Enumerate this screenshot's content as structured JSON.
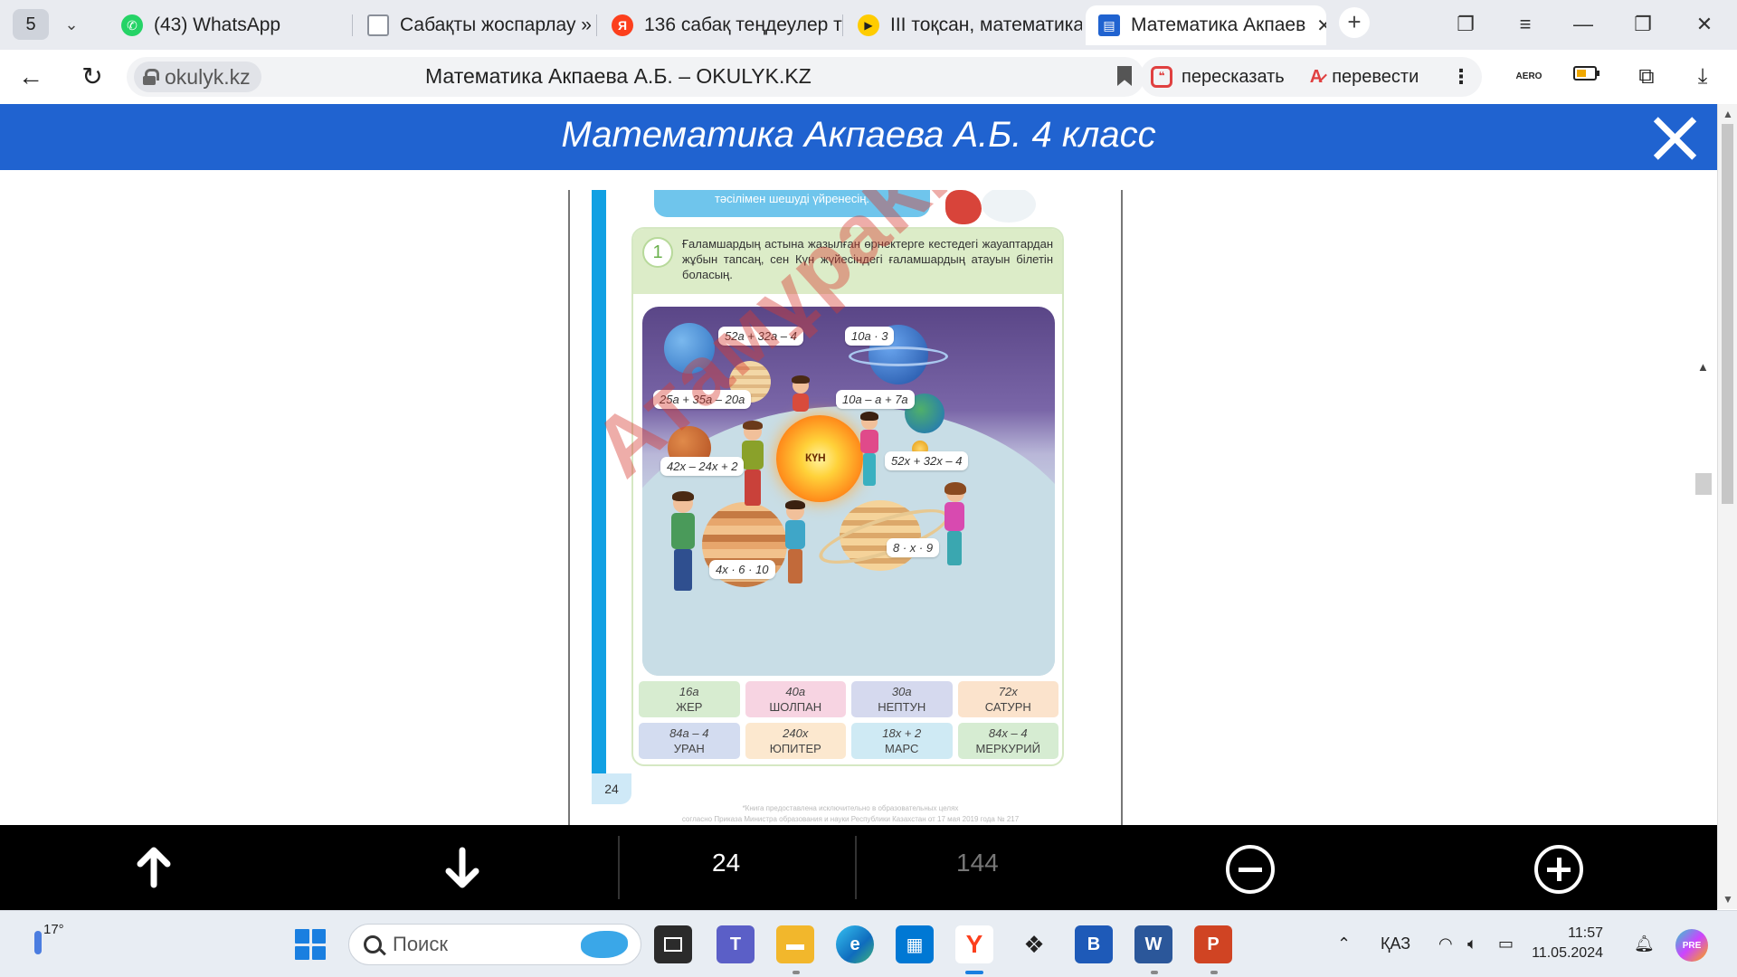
{
  "browser": {
    "tab_count": "5",
    "tabs": [
      {
        "label": "(43) WhatsApp",
        "icon": "whatsapp-icon",
        "color": "#25d366"
      },
      {
        "label": "Сабақты жоспарлау »",
        "icon": "document-icon",
        "color": "#8a8f99"
      },
      {
        "label": "136 сабақ теңдеулер т",
        "icon": "yandex-icon",
        "color": "#fc3f1d"
      },
      {
        "label": "III тоқсан, математика",
        "icon": "video-play-icon",
        "color": "#ffcc00"
      },
      {
        "label": "Математика Акпаев",
        "icon": "book-icon",
        "color": "#2063d0"
      }
    ],
    "domain": "okulyk.kz",
    "page_title": "Математика Акпаева А.Б. – OKULYK.KZ",
    "retell_label": "пересказать",
    "translate_label": "перевести",
    "aero_label": "AERO"
  },
  "header": {
    "title": "Математика Акпаева А.Б. 4 класс"
  },
  "book": {
    "top_banner": "тәсілімен шешуді үйренесің.",
    "exercise_number": "1",
    "exercise_text": "Ғаламшардың астына жазылған өрнектерге кестедегі жауаптардан жұбын тапсаң, сен Күн жүйесіндегі ғаламшардың атауын білетін боласың.",
    "sun_label": "КҮН",
    "expressions": [
      "52a + 32a – 4",
      "10a · 3",
      "25a + 35a – 20a",
      "10a – a + 7a",
      "42x – 24x + 2",
      "52x + 32x – 4",
      "8 · x · 9",
      "4x · 6 · 10"
    ],
    "answers": [
      {
        "expr": "16a",
        "name": "ЖЕР",
        "color": "#d7ecd0"
      },
      {
        "expr": "40a",
        "name": "ШОЛПАН",
        "color": "#f7d4e2"
      },
      {
        "expr": "30a",
        "name": "НЕПТУН",
        "color": "#d5d9ee"
      },
      {
        "expr": "72x",
        "name": "САТУРН",
        "color": "#fbe3cc"
      },
      {
        "expr": "84a – 4",
        "name": "УРАН",
        "color": "#d3dcf0"
      },
      {
        "expr": "240x",
        "name": "ЮПИТЕР",
        "color": "#fce8cf"
      },
      {
        "expr": "18x + 2",
        "name": "МАРС",
        "color": "#cfeaf4"
      },
      {
        "expr": "84x – 4",
        "name": "МЕРКУРИЙ",
        "color": "#d6ecd2"
      }
    ],
    "page_number": "24",
    "footnote_1": "*Книга предоставлена исключительно в образовательных целях",
    "footnote_2": "согласно Приказа Министра образования и науки Республики Казахстан от 17 мая 2019 года № 217",
    "watermark": "АтамұраКітап"
  },
  "viewer": {
    "current_page": "24",
    "total_pages": "144"
  },
  "taskbar": {
    "temperature": "17°",
    "search_placeholder": "Поиск",
    "language": "ҚАЗ",
    "time": "11:57",
    "date": "11.05.2024"
  }
}
